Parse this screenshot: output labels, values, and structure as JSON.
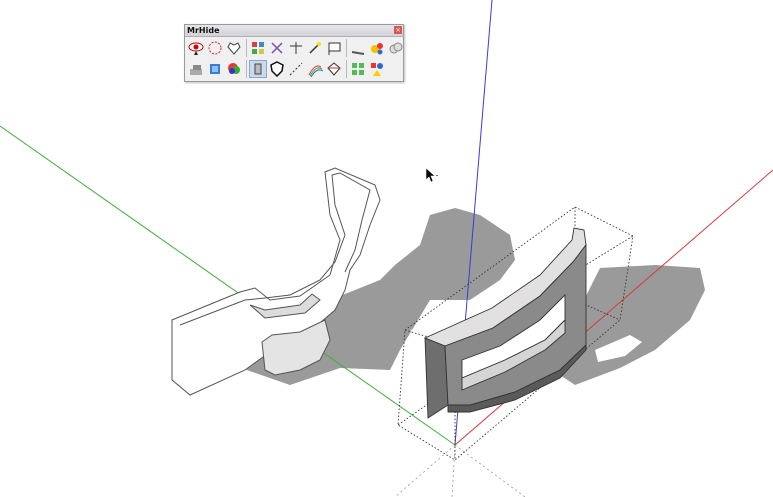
{
  "toolbar": {
    "title": "MrHide",
    "close_glyph": "×",
    "row1_icons": [
      "eye-icon",
      "dashed-circle-icon",
      "heart-outline-icon",
      "grid-select-icon",
      "magnet-arrows-icon",
      "cross-arrow-icon",
      "wand-icon",
      "text-label-icon",
      "ruler-icon",
      "spheres-icon",
      "cloud-icon"
    ],
    "row2_icons": [
      "layers-icon",
      "blue-box-icon",
      "color-wheel-icon",
      "cylinder-icon",
      "shield-icon",
      "dashed-lines-icon",
      "rainbow-icon",
      "gem-icon",
      "green-grid-icon",
      "shapes-icon"
    ]
  },
  "axes": {
    "red": "#d33b3b",
    "green": "#3fae3f",
    "blue": "#3b3bd8"
  },
  "colors": {
    "shadow": "#9a9a9a",
    "face": "#eeeeee",
    "dark_face": "#6e6e6e",
    "edge": "#4a4a4a"
  },
  "cursor": {
    "name": "arrow-cursor-icon"
  }
}
